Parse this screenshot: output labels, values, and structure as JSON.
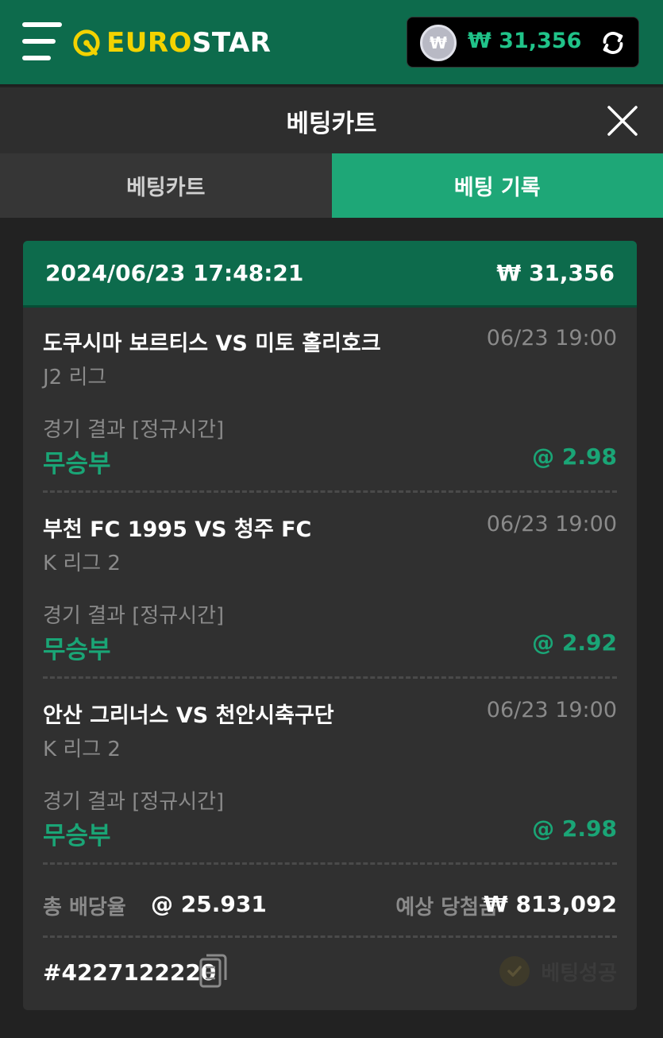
{
  "header": {
    "logo": {
      "part1": "EURO",
      "part2": "STAR"
    },
    "balance": {
      "currency_symbol": "₩",
      "amount": "₩ 31,356"
    }
  },
  "cart": {
    "title": "베팅카트",
    "tabs": [
      {
        "label": "베팅카트",
        "active": false
      },
      {
        "label": "베팅 기록",
        "active": true
      }
    ]
  },
  "ticket": {
    "datetime": "2024/06/23 17:48:21",
    "amount": "₩ 31,356",
    "bets": [
      {
        "teams": "도쿠시마 보르티스 VS 미토 홀리호크",
        "time": "06/23 19:00",
        "league": "J2 리그",
        "market": "경기 결과 [정규시간]",
        "pick": "무승부",
        "odds": "@ 2.98"
      },
      {
        "teams": "부천 FC 1995 VS 청주 FC",
        "time": "06/23 19:00",
        "league": "K 리그 2",
        "market": "경기 결과 [정규시간]",
        "pick": "무승부",
        "odds": "@ 2.92"
      },
      {
        "teams": "안산 그리너스 VS 천안시축구단",
        "time": "06/23 19:00",
        "league": "K 리그 2",
        "market": "경기 결과 [정규시간]",
        "pick": "무승부",
        "odds": "@ 2.98"
      }
    ],
    "total_odds_label": "총 배당율",
    "total_odds": "@ 25.931",
    "expected_win_label": "예상 당첨금",
    "expected_win": "₩ 813,092",
    "ticket_id": "#4227122220",
    "status": "베팅성공"
  },
  "colors": {
    "brand_green": "#0d6b4c",
    "accent_green": "#1aa576",
    "logo_yellow": "#f3d300"
  },
  "icons": [
    "menu-icon",
    "logo-icon",
    "won-coin-icon",
    "refresh-icon",
    "close-icon",
    "copy-icon",
    "check-icon"
  ]
}
